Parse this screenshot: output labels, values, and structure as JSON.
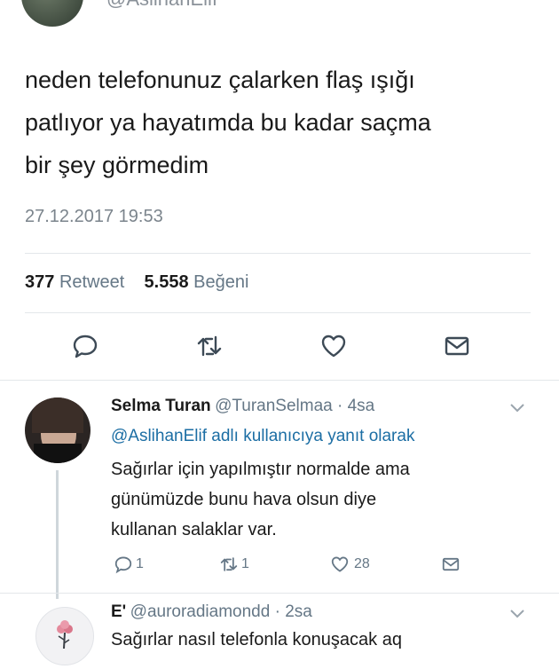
{
  "tweet": {
    "author_handle": "@AslihanElif",
    "text_line1": "neden telefonunuz çalarken flaş ışığı",
    "text_line2": "patlıyor ya hayatımda bu kadar saçma",
    "text_line3": "bir şey görmedim",
    "date": "27.12.2017 19:53",
    "retweet_count": "377",
    "retweet_label": "Retweet",
    "like_count": "5.558",
    "like_label": "Beğeni"
  },
  "actions": {
    "icons": [
      "reply-icon",
      "retweet-icon",
      "like-icon",
      "message-icon"
    ]
  },
  "replies": [
    {
      "name": "Selma Turan",
      "handle": "@TuranSelmaa · 4sa",
      "reply_to": "@AslihanElif adlı kullanıcıya yanıt olarak",
      "text_line1": "Sağırlar için yapılmıştır normalde ama",
      "text_line2": "günümüzde bunu hava olsun diye",
      "text_line3": "kullanan salaklar var.",
      "reply_count": "1",
      "retweet_count": "1",
      "like_count": "28"
    },
    {
      "name": "E'",
      "handle": "@auroradiamondd · 2sa",
      "text_line1": "Sağırlar nasıl telefonla konuşacak aq"
    }
  ],
  "colors": {
    "accent": "#1c6ea4",
    "muted": "#657786",
    "divider": "#e3e7ea"
  }
}
